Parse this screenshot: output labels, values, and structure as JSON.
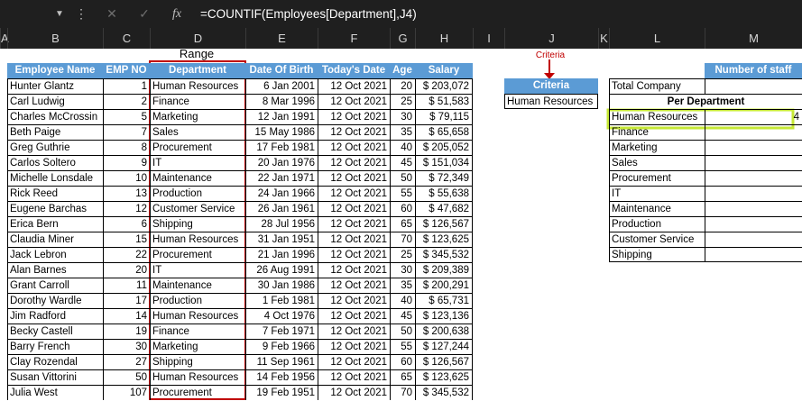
{
  "formula_bar": {
    "formula": "=COUNTIF(Employees[Department],J4)",
    "cancel_icon": "close-icon",
    "enter_icon": "check-icon",
    "fx_label": "fx"
  },
  "columns": [
    "A",
    "B",
    "C",
    "D",
    "E",
    "F",
    "G",
    "H",
    "I",
    "J",
    "K",
    "L",
    "M"
  ],
  "labels": {
    "range": "Range",
    "criteria_note": "Criteria"
  },
  "table": {
    "headers": [
      "Employee Name",
      "EMP NO",
      "Department",
      "Date Of Birth",
      "Today's Date",
      "Age",
      "Salary"
    ],
    "rows": [
      [
        "Hunter Glantz",
        "1",
        "Human Resources",
        "6 Jan 2001",
        "12 Oct 2021",
        "20",
        "$ 203,072"
      ],
      [
        "Carl Ludwig",
        "2",
        "Finance",
        "8 Mar 1996",
        "12 Oct 2021",
        "25",
        "$ 51,583"
      ],
      [
        "Charles McCrossin",
        "5",
        "Marketing",
        "12 Jan 1991",
        "12 Oct 2021",
        "30",
        "$ 79,115"
      ],
      [
        "Beth Paige",
        "7",
        "Sales",
        "15 May 1986",
        "12 Oct 2021",
        "35",
        "$ 65,658"
      ],
      [
        "Greg Guthrie",
        "8",
        "Procurement",
        "17 Feb 1981",
        "12 Oct 2021",
        "40",
        "$ 205,052"
      ],
      [
        "Carlos Soltero",
        "9",
        "IT",
        "20 Jan 1976",
        "12 Oct 2021",
        "45",
        "$ 151,034"
      ],
      [
        "Michelle Lonsdale",
        "10",
        "Maintenance",
        "22 Jan 1971",
        "12 Oct 2021",
        "50",
        "$ 72,349"
      ],
      [
        "Rick Reed",
        "13",
        "Production",
        "24 Jan 1966",
        "12 Oct 2021",
        "55",
        "$ 55,638"
      ],
      [
        "Eugene Barchas",
        "12",
        "Customer Service",
        "26 Jan 1961",
        "12 Oct 2021",
        "60",
        "$ 47,682"
      ],
      [
        "Erica Bern",
        "6",
        "Shipping",
        "28 Jul 1956",
        "12 Oct 2021",
        "65",
        "$ 126,567"
      ],
      [
        "Claudia Miner",
        "15",
        "Human Resources",
        "31 Jan 1951",
        "12 Oct 2021",
        "70",
        "$ 123,625"
      ],
      [
        "Jack Lebron",
        "22",
        "Procurement",
        "21 Jan 1996",
        "12 Oct 2021",
        "25",
        "$ 345,532"
      ],
      [
        "Alan Barnes",
        "20",
        "IT",
        "26 Aug 1991",
        "12 Oct 2021",
        "30",
        "$ 209,389"
      ],
      [
        "Grant Carroll",
        "11",
        "Maintenance",
        "30 Jan 1986",
        "12 Oct 2021",
        "35",
        "$ 200,291"
      ],
      [
        "Dorothy Wardle",
        "17",
        "Production",
        "1 Feb 1981",
        "12 Oct 2021",
        "40",
        "$ 65,731"
      ],
      [
        "Jim Radford",
        "14",
        "Human Resources",
        "4 Oct 1976",
        "12 Oct 2021",
        "45",
        "$ 123,136"
      ],
      [
        "Becky Castell",
        "19",
        "Finance",
        "7 Feb 1971",
        "12 Oct 2021",
        "50",
        "$ 200,638"
      ],
      [
        "Barry French",
        "30",
        "Marketing",
        "9 Feb 1966",
        "12 Oct 2021",
        "55",
        "$ 127,244"
      ],
      [
        "Clay Rozendal",
        "27",
        "Shipping",
        "11 Sep 1961",
        "12 Oct 2021",
        "60",
        "$ 126,567"
      ],
      [
        "Susan Vittorini",
        "50",
        "Human Resources",
        "14 Feb 1956",
        "12 Oct 2021",
        "65",
        "$ 123,625"
      ],
      [
        "Julia West",
        "107",
        "Procurement",
        "19 Feb 1951",
        "12 Oct 2021",
        "70",
        "$ 345,532"
      ]
    ]
  },
  "criteria": {
    "header": "Criteria",
    "value": "Human Resources"
  },
  "staff": {
    "header": "Number of staff",
    "total_label": "Total Company",
    "per_dept_label": "Per Department",
    "items": [
      {
        "name": "Human Resources",
        "count": "4"
      },
      {
        "name": "Finance",
        "count": ""
      },
      {
        "name": "Marketing",
        "count": ""
      },
      {
        "name": "Sales",
        "count": ""
      },
      {
        "name": "Procurement",
        "count": ""
      },
      {
        "name": "IT",
        "count": ""
      },
      {
        "name": "Maintenance",
        "count": ""
      },
      {
        "name": "Production",
        "count": ""
      },
      {
        "name": "Customer Service",
        "count": ""
      },
      {
        "name": "Shipping",
        "count": ""
      }
    ]
  },
  "colors": {
    "header_blue": "#5b9bd5",
    "range_box": "#c00000",
    "selection": "#c6e836",
    "dark_bar": "#1f1f1f"
  }
}
